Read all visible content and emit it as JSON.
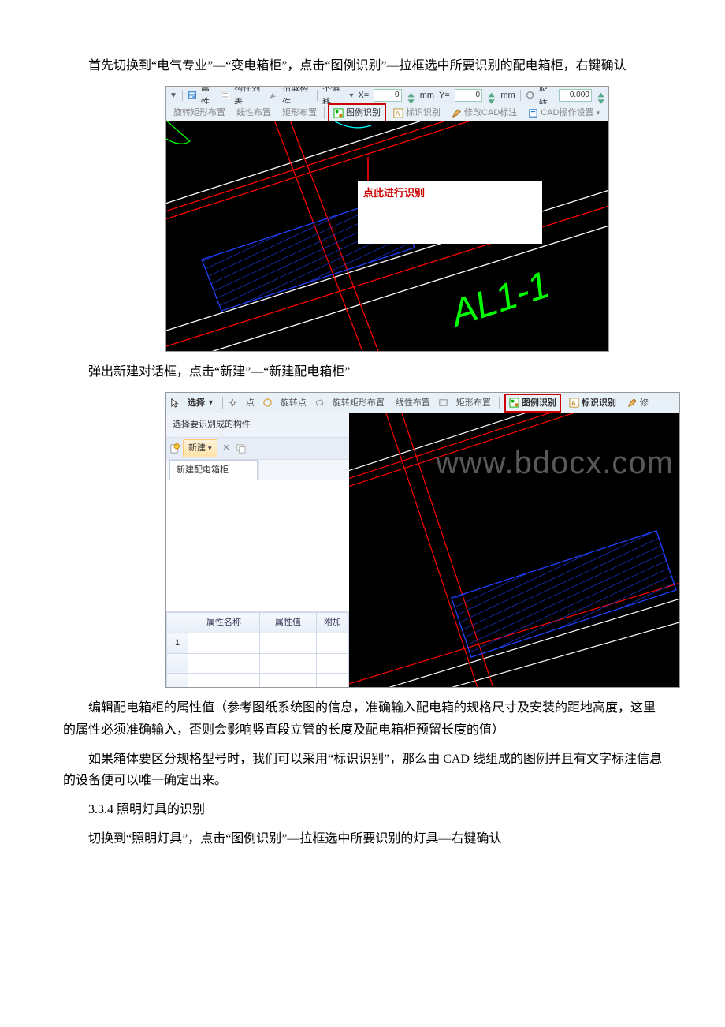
{
  "paragraphs": {
    "p1": "首先切换到“电气专业”—“变电箱柜”，点击“图例识别”—拉框选中所要识别的配电箱柜，右键确认",
    "p2": "弹出新建对话框，点击“新建”—“新建配电箱柜”",
    "p3": "编辑配电箱柜的属性值（参考图纸系统图的信息，准确输入配电箱的规格尺寸及安装的距地高度，这里的属性必须准确输入，否则会影响竖直段立管的长度及配电箱柜预留长度的值）",
    "p4": "如果箱体要区分规格型号时，我们可以采用“标识识别”，那么由 CAD 线组成的图例并且有文字标注信息的设备便可以唯一确定出来。",
    "p5": "3.3.4 照明灯具的识别",
    "p6": "切换到“照明灯具”，点击“图例识别”—拉框选中所要识别的灯具—右键确认"
  },
  "fig1": {
    "toolbar1": {
      "props": "属性",
      "member_list": "构件列表",
      "pick_member": "拾取构件",
      "no_offset": "不偏移",
      "x_eq": "X=",
      "mm1": "mm",
      "y_eq": "Y=",
      "mm2": "mm",
      "rotate": "旋转",
      "zero": "0",
      "deg": "0.000"
    },
    "toolbar2": {
      "rotate_rect": "旋转矩形布置",
      "line_layout": "线性布置",
      "rect_layout": "矩形布置",
      "legend_rec": "图例识别",
      "mark_rec": "标识识别",
      "edit_cad": "修改CAD标注",
      "cad_ops": "CAD操作设置"
    },
    "callout": "点此进行识别",
    "label": "AL1-1"
  },
  "fig2": {
    "toolbar": {
      "select": "选择",
      "point": "点",
      "rot_point": "旋转点",
      "rot_rect": "旋转矩形布置",
      "line_layout": "线性布置",
      "rect_layout": "矩形布置",
      "legend_rec": "图例识别",
      "mark_rec": "标识识别",
      "edit": "修"
    },
    "side": {
      "choose": "选择要识别成的构件",
      "new_btn": "新建",
      "dropdown_item": "新建配电箱柜",
      "col_name": "属性名称",
      "col_val": "属性值",
      "col_add": "附加",
      "row1": "1"
    },
    "watermark": "www.bdocx.com"
  }
}
